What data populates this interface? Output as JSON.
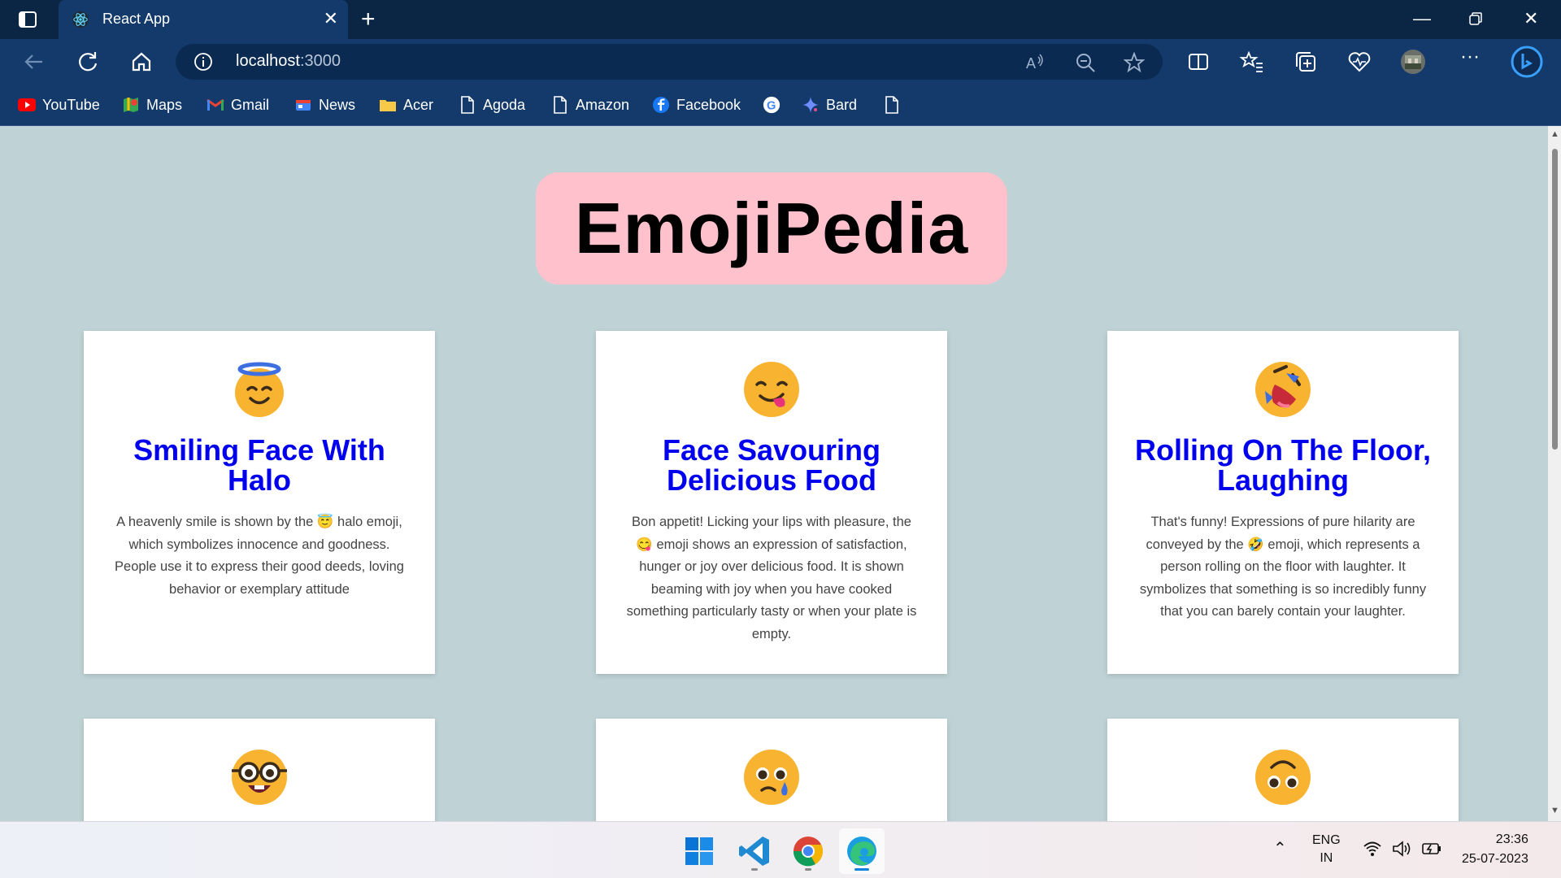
{
  "browser": {
    "tab_title": "React App",
    "url_host": "localhost",
    "url_port": ":3000",
    "bookmarks": [
      "YouTube",
      "Maps",
      "Gmail",
      "News",
      "Acer",
      "Agoda",
      "Amazon",
      "Facebook",
      "",
      "Bard",
      ""
    ]
  },
  "page": {
    "heading": "EmojiPedia",
    "cards": [
      {
        "emoji": "innocent-icon",
        "title": "Smiling Face With Halo",
        "description": "A heavenly smile is shown by the 😇 halo emoji, which symbolizes innocence and goodness. People use it to express their good deeds, loving behavior or exemplary attitude"
      },
      {
        "emoji": "yum-icon",
        "title": "Face Savouring Delicious Food",
        "description": "Bon appetit! Licking your lips with pleasure, the 😋 emoji shows an expression of satisfaction, hunger or joy over delicious food. It is shown beaming with joy when you have cooked something particularly tasty or when your plate is empty."
      },
      {
        "emoji": "rofl-icon",
        "title": "Rolling On The Floor, Laughing",
        "description": "That's funny! Expressions of pure hilarity are conveyed by the 🤣 emoji, which represents a person rolling on the floor with laughter. It symbolizes that something is so incredibly funny that you can barely contain your laughter."
      },
      {
        "emoji": "nerd-icon",
        "title": "",
        "description": ""
      },
      {
        "emoji": "holding-back-tears-icon",
        "title": "",
        "description": ""
      },
      {
        "emoji": "upside-down-face-icon",
        "title": "",
        "description": ""
      }
    ]
  },
  "taskbar": {
    "language_top": "ENG",
    "language_bottom": "IN",
    "time": "23:36",
    "date": "25-07-2023"
  },
  "colors": {
    "page_bg": "#bfd3d6",
    "heading_bg": "#ffc1cc",
    "card_title": "#0000ee",
    "browser_frame": "#133a6b"
  }
}
